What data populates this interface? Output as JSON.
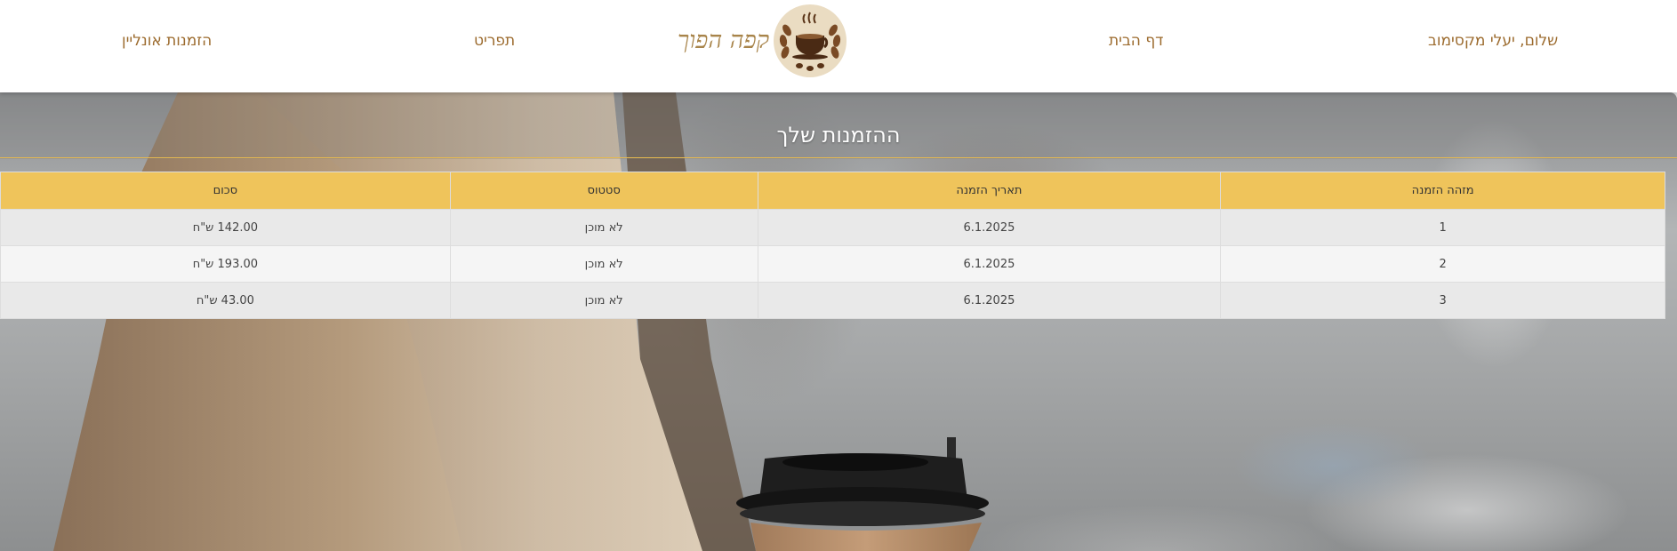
{
  "header": {
    "greeting": "שלום, יעלי מקסימוב",
    "nav_home": "דף הבית",
    "brand": "קפה הפוך",
    "nav_menu": "תפריט",
    "nav_online_orders": "הזמנות אונליין"
  },
  "page": {
    "title": "ההזמנות שלך"
  },
  "orders": {
    "columns": [
      "מזהה הזמנה",
      "תאריך הזמנה",
      "סטטוס",
      "סכום"
    ],
    "rows": [
      {
        "id": "1",
        "date": "6.1.2025",
        "status": "לא מוכן",
        "total": "142.00 ש\"ח"
      },
      {
        "id": "2",
        "date": "6.1.2025",
        "status": "לא מוכן",
        "total": "193.00 ש\"ח"
      },
      {
        "id": "3",
        "date": "6.1.2025",
        "status": "לא מוכן",
        "total": "43.00 ש\"ח"
      }
    ]
  },
  "colors": {
    "accent": "#efc45b",
    "nav_text": "#9c6b2e",
    "brand_text": "#a8844a",
    "title_rule": "#e6b94f"
  },
  "icons": {
    "logo": "coffee-cup-logo-icon"
  }
}
